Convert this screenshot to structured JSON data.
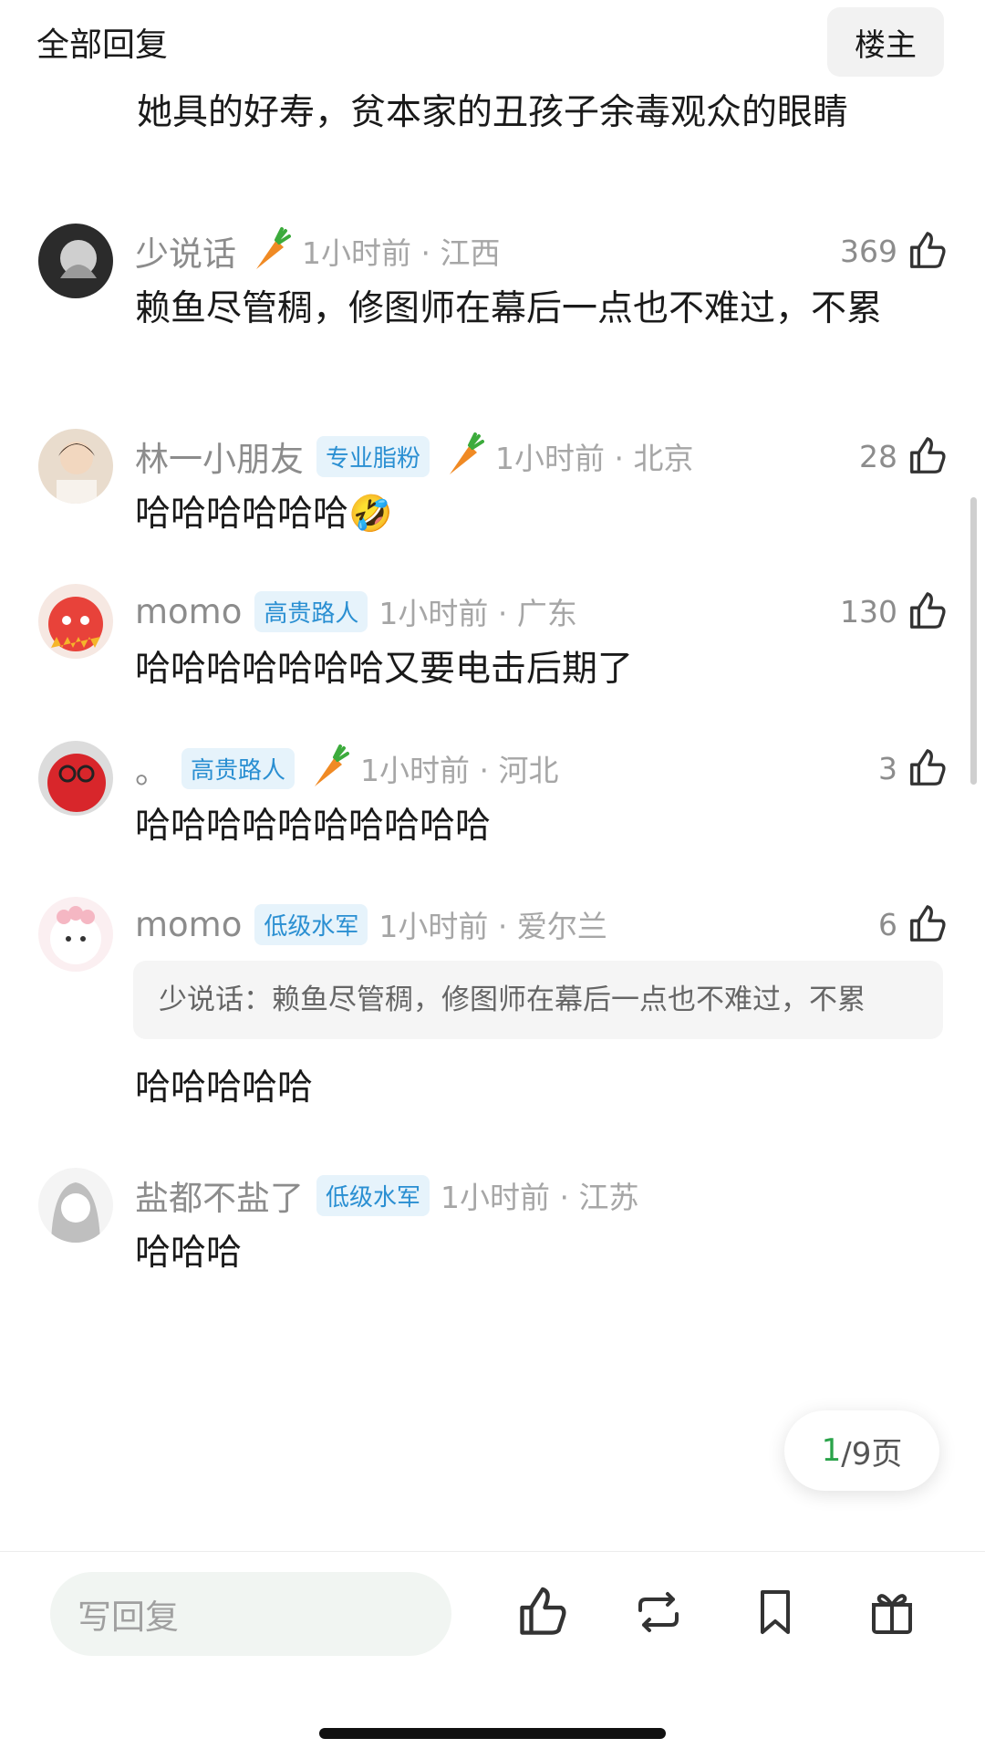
{
  "header": {
    "title": "全部回复",
    "owner_button": "楼主"
  },
  "partial_comment": {
    "text": "她具的好寿，贫本家的丑孩子余毒观众的眼睛"
  },
  "comments": [
    {
      "username": "少说话",
      "badge": "",
      "time_location": "1小时前 · 江西",
      "likes": "369",
      "text": "赖鱼尽管稠，修图师在幕后一点也不难过，不累"
    },
    {
      "username": "林一小朋友",
      "badge": "专业脂粉",
      "time_location": "1小时前 · 北京",
      "likes": "28",
      "text": "哈哈哈哈哈哈🤣"
    },
    {
      "username": "momo",
      "badge": "高贵路人",
      "time_location": "1小时前 · 广东",
      "likes": "130",
      "text": "哈哈哈哈哈哈哈又要电击后期了"
    },
    {
      "username": "。",
      "badge": "高贵路人",
      "time_location": "1小时前 · 河北",
      "likes": "3",
      "text": "哈哈哈哈哈哈哈哈哈哈"
    },
    {
      "username": "momo",
      "badge": "低级水军",
      "time_location": "1小时前 · 爱尔兰",
      "likes": "6",
      "quote": "少说话：赖鱼尽管稠，修图师在幕后一点也不难过，不累",
      "text": "哈哈哈哈哈"
    },
    {
      "username": "盐都不盐了",
      "badge": "低级水军",
      "time_location": "1小时前 · 江苏",
      "likes": "",
      "text": "哈哈哈"
    }
  ],
  "pager": {
    "current": "1",
    "total": "/9页"
  },
  "bottom_bar": {
    "reply_placeholder": "写回复"
  },
  "colors": {
    "badge_text": "#2a8fd2",
    "badge_bg": "#e6f3fb",
    "pager_current": "#2aa34a",
    "meta_gray": "#8c8c8c"
  },
  "icons": [
    "thumb-up-icon",
    "carrot-icon",
    "repost-icon",
    "bookmark-icon",
    "gift-icon"
  ]
}
